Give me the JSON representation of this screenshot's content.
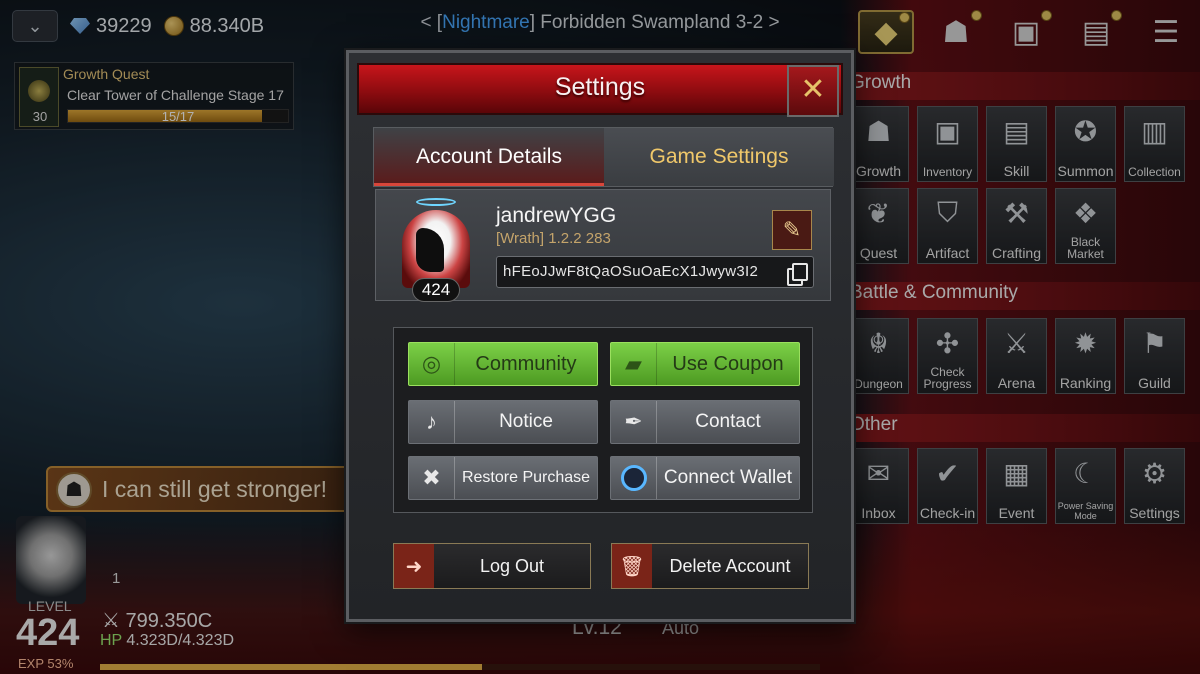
{
  "topbar": {
    "gems": "39229",
    "gold": "88.340B"
  },
  "stage": {
    "prefix": "< [",
    "difficulty": "Nightmare",
    "name": "] Forbidden Swampland 3-2 >"
  },
  "quest": {
    "title": "Growth Quest",
    "desc": "Clear Tower of Challenge Stage 17",
    "progress": "15/17",
    "progress_fraction": 0.88,
    "icon_number": "30"
  },
  "bubble": {
    "text": "I can still get stronger!"
  },
  "player": {
    "level_label": "LEVEL",
    "level": "424",
    "exp": "EXP 53%",
    "exp_fraction": 0.53,
    "power": "799.350C",
    "hp_label": "HP",
    "hp_value": "4.323D/4.323D",
    "count": "1",
    "lv_bottom": "Lv.12",
    "auto": "Auto"
  },
  "right_menu": {
    "growth_title": "Growth",
    "growth_items": [
      "Growth",
      "Inventory",
      "Skill",
      "Summon",
      "Collection"
    ],
    "growth_items2": [
      "Quest",
      "Artifact",
      "Crafting",
      "Black Market"
    ],
    "battle_title": "Battle & Community",
    "battle_items": [
      "Dungeon",
      "Check Progress",
      "Arena",
      "Ranking",
      "Guild"
    ],
    "other_title": "Other",
    "other_items": [
      "Inbox",
      "Check-in",
      "Event",
      "Power Saving Mode",
      "Settings"
    ]
  },
  "modal": {
    "title": "Settings",
    "tabs": [
      "Account Details",
      "Game Settings"
    ],
    "username": "jandrewYGG",
    "version": "[Wrath] 1.2.2 283",
    "uid": "hFEoJJwF8tQaOSuOaEcX1Jwyw3I2",
    "avatar_level": "424",
    "buttons": {
      "community": "Community",
      "use_coupon": "Use Coupon",
      "notice": "Notice",
      "contact": "Contact",
      "restore_purchase": "Restore Purchase",
      "connect_wallet": "Connect Wallet"
    },
    "log_out": "Log Out",
    "delete_account": "Delete Account"
  },
  "colors": {
    "accent_red": "#c7151b",
    "green_button": "#7cd047",
    "difficulty_blue": "#4aa8ff",
    "gold_text": "#f0c86a"
  }
}
